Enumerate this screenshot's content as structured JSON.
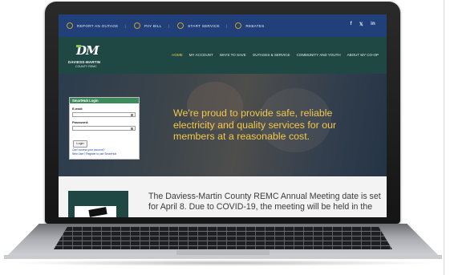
{
  "topbar": {
    "items": [
      {
        "label": "REPORT AN OUTAGE",
        "icon": "bulb-icon"
      },
      {
        "label": "PAY BILL",
        "icon": "dollar-icon"
      },
      {
        "label": "START SERVICE",
        "icon": "house-icon"
      },
      {
        "label": "REBATES",
        "icon": "rebate-icon"
      }
    ],
    "social": [
      "f",
      "𝕏",
      "in"
    ]
  },
  "logo": {
    "mark": "DM",
    "name": "DAVIESS-MARTIN",
    "sub": "COUNTY REMC"
  },
  "nav": {
    "items": [
      "HOME",
      "MY ACCOUNT",
      "WAYS TO SAVE",
      "OUTAGES & SERVICE",
      "COMMUNITY AND YOUTH",
      "ABOUT MY CO-OP"
    ],
    "active": "HOME"
  },
  "hero": {
    "text": "We're proud to provide safe, reliable electricity and quality services for our members at a reasonable cost."
  },
  "login": {
    "title": "SmartHub Login",
    "email_label": "E-mail:",
    "password_label": "Password:",
    "button": "Login",
    "link1": "Can't access your account?",
    "link2": "New User? Register to use SmartHub"
  },
  "news": {
    "text": "The Daviess-Martin County REMC Annual Meeting date is set for April 8. Due to COVID-19, the meeting will be held in the"
  },
  "colors": {
    "topbar": "#21407a",
    "navbar": "#1f4845",
    "accent": "#f2c94c",
    "login_header": "#3d8a5b"
  }
}
